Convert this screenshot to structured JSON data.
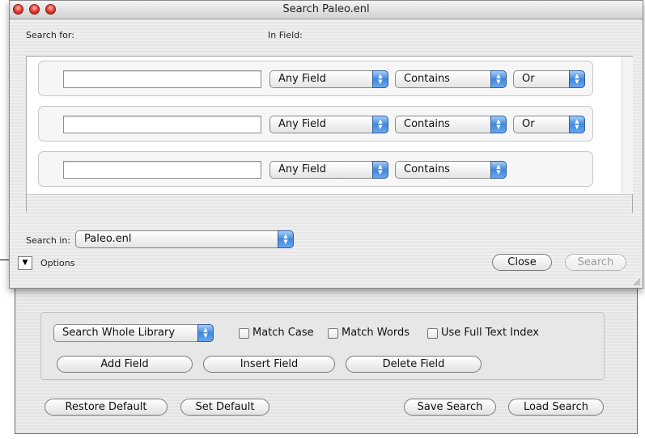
{
  "window": {
    "title": "Search Paleo.enl"
  },
  "labels": {
    "search_for": "Search for:",
    "in_field": "In Field:",
    "search_in": "Search in:",
    "options": "Options"
  },
  "criteria_rows": [
    {
      "value": "",
      "field": "Any Field",
      "operator": "Contains",
      "boolean": "Or"
    },
    {
      "value": "",
      "field": "Any Field",
      "operator": "Contains",
      "boolean": "Or"
    },
    {
      "value": "",
      "field": "Any Field",
      "operator": "Contains"
    }
  ],
  "search_in": {
    "value": "Paleo.enl"
  },
  "buttons": {
    "close": "Close",
    "search": "Search"
  },
  "options": {
    "scope": "Search Whole Library",
    "match_case": "Match Case",
    "match_words": "Match Words",
    "use_full_text": "Use Full Text Index",
    "add_field": "Add Field",
    "insert_field": "Insert Field",
    "delete_field": "Delete Field",
    "restore_default": "Restore Default",
    "set_default": "Set Default",
    "save_search": "Save Search",
    "load_search": "Load Search"
  },
  "icons": {
    "close_light": "close-icon",
    "minimize_light": "minimize-icon",
    "zoom_light": "zoom-icon",
    "disclosure": "disclosure-triangle-icon",
    "popup": "up-down-arrows-icon"
  }
}
